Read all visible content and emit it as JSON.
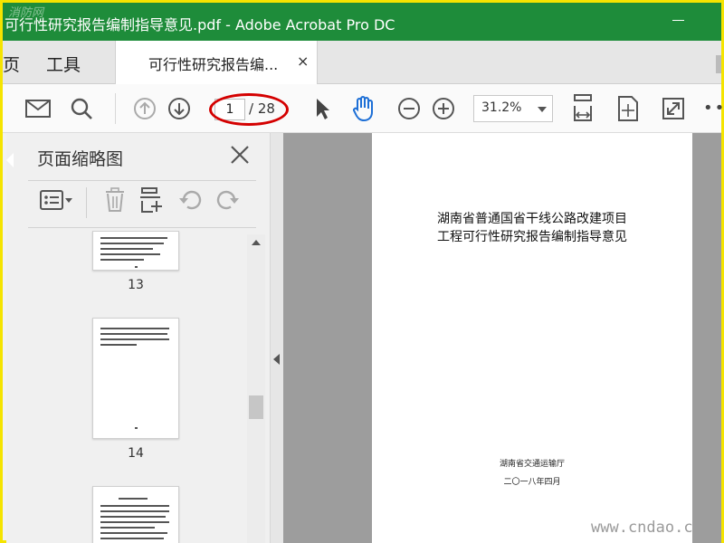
{
  "window": {
    "title": "可行性研究报告编制指导意见.pdf - Adobe Acrobat Pro DC",
    "logo_text": "消防网"
  },
  "tabs": {
    "home_label": "页",
    "tools_label": "工具",
    "document_tab_label": "可行性研究报告编...",
    "close_glyph": "×"
  },
  "toolbar": {
    "email_icon": "envelope-icon",
    "search_icon": "search-icon",
    "current_page": "1",
    "total_pages": "/ 28",
    "zoom_value": "31.2%",
    "more_glyph": "••"
  },
  "thumbnail_panel": {
    "title": "页面缩略图",
    "page_numbers": [
      "13",
      "14"
    ]
  },
  "document": {
    "title_line1": "湖南省普通国省干线公路改建项目",
    "title_line2": "工程可行性研究报告编制指导意见",
    "issuer": "湖南省交通运输厅",
    "date": "二〇一八年四月"
  },
  "watermark": {
    "site": "www.cndao.c"
  },
  "colors": {
    "titlebar": "#1e8c3a",
    "annotation_red": "#d40000",
    "frame_yellow": "#f5e400",
    "hand_tool_blue": "#1d6fd6"
  }
}
